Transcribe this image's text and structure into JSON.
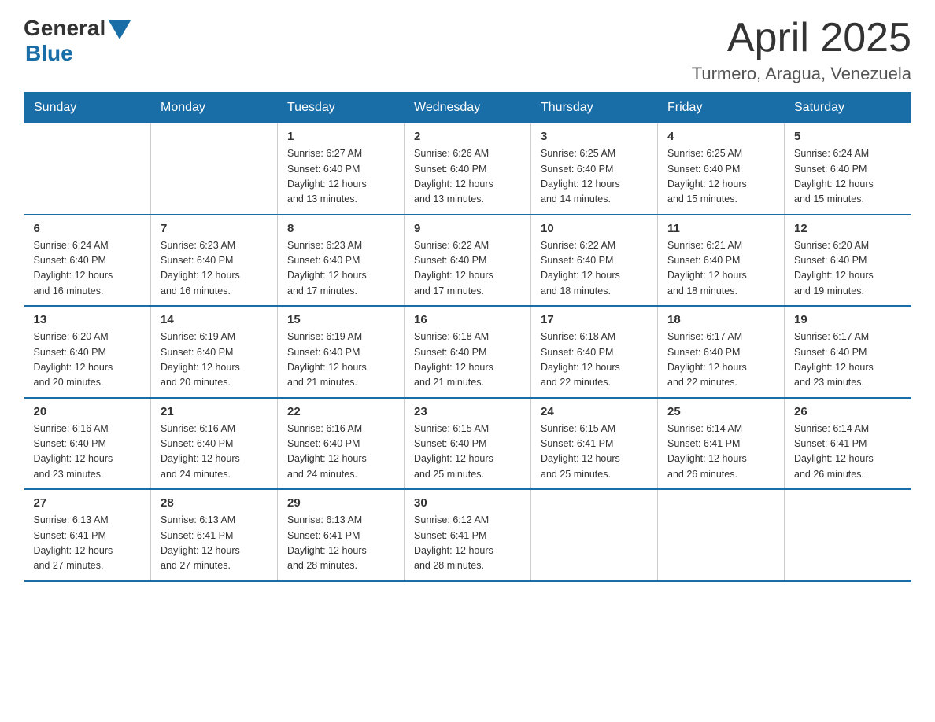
{
  "logo": {
    "general": "General",
    "blue": "Blue"
  },
  "title": "April 2025",
  "location": "Turmero, Aragua, Venezuela",
  "weekdays": [
    "Sunday",
    "Monday",
    "Tuesday",
    "Wednesday",
    "Thursday",
    "Friday",
    "Saturday"
  ],
  "weeks": [
    [
      {
        "day": "",
        "info": ""
      },
      {
        "day": "",
        "info": ""
      },
      {
        "day": "1",
        "info": "Sunrise: 6:27 AM\nSunset: 6:40 PM\nDaylight: 12 hours\nand 13 minutes."
      },
      {
        "day": "2",
        "info": "Sunrise: 6:26 AM\nSunset: 6:40 PM\nDaylight: 12 hours\nand 13 minutes."
      },
      {
        "day": "3",
        "info": "Sunrise: 6:25 AM\nSunset: 6:40 PM\nDaylight: 12 hours\nand 14 minutes."
      },
      {
        "day": "4",
        "info": "Sunrise: 6:25 AM\nSunset: 6:40 PM\nDaylight: 12 hours\nand 15 minutes."
      },
      {
        "day": "5",
        "info": "Sunrise: 6:24 AM\nSunset: 6:40 PM\nDaylight: 12 hours\nand 15 minutes."
      }
    ],
    [
      {
        "day": "6",
        "info": "Sunrise: 6:24 AM\nSunset: 6:40 PM\nDaylight: 12 hours\nand 16 minutes."
      },
      {
        "day": "7",
        "info": "Sunrise: 6:23 AM\nSunset: 6:40 PM\nDaylight: 12 hours\nand 16 minutes."
      },
      {
        "day": "8",
        "info": "Sunrise: 6:23 AM\nSunset: 6:40 PM\nDaylight: 12 hours\nand 17 minutes."
      },
      {
        "day": "9",
        "info": "Sunrise: 6:22 AM\nSunset: 6:40 PM\nDaylight: 12 hours\nand 17 minutes."
      },
      {
        "day": "10",
        "info": "Sunrise: 6:22 AM\nSunset: 6:40 PM\nDaylight: 12 hours\nand 18 minutes."
      },
      {
        "day": "11",
        "info": "Sunrise: 6:21 AM\nSunset: 6:40 PM\nDaylight: 12 hours\nand 18 minutes."
      },
      {
        "day": "12",
        "info": "Sunrise: 6:20 AM\nSunset: 6:40 PM\nDaylight: 12 hours\nand 19 minutes."
      }
    ],
    [
      {
        "day": "13",
        "info": "Sunrise: 6:20 AM\nSunset: 6:40 PM\nDaylight: 12 hours\nand 20 minutes."
      },
      {
        "day": "14",
        "info": "Sunrise: 6:19 AM\nSunset: 6:40 PM\nDaylight: 12 hours\nand 20 minutes."
      },
      {
        "day": "15",
        "info": "Sunrise: 6:19 AM\nSunset: 6:40 PM\nDaylight: 12 hours\nand 21 minutes."
      },
      {
        "day": "16",
        "info": "Sunrise: 6:18 AM\nSunset: 6:40 PM\nDaylight: 12 hours\nand 21 minutes."
      },
      {
        "day": "17",
        "info": "Sunrise: 6:18 AM\nSunset: 6:40 PM\nDaylight: 12 hours\nand 22 minutes."
      },
      {
        "day": "18",
        "info": "Sunrise: 6:17 AM\nSunset: 6:40 PM\nDaylight: 12 hours\nand 22 minutes."
      },
      {
        "day": "19",
        "info": "Sunrise: 6:17 AM\nSunset: 6:40 PM\nDaylight: 12 hours\nand 23 minutes."
      }
    ],
    [
      {
        "day": "20",
        "info": "Sunrise: 6:16 AM\nSunset: 6:40 PM\nDaylight: 12 hours\nand 23 minutes."
      },
      {
        "day": "21",
        "info": "Sunrise: 6:16 AM\nSunset: 6:40 PM\nDaylight: 12 hours\nand 24 minutes."
      },
      {
        "day": "22",
        "info": "Sunrise: 6:16 AM\nSunset: 6:40 PM\nDaylight: 12 hours\nand 24 minutes."
      },
      {
        "day": "23",
        "info": "Sunrise: 6:15 AM\nSunset: 6:40 PM\nDaylight: 12 hours\nand 25 minutes."
      },
      {
        "day": "24",
        "info": "Sunrise: 6:15 AM\nSunset: 6:41 PM\nDaylight: 12 hours\nand 25 minutes."
      },
      {
        "day": "25",
        "info": "Sunrise: 6:14 AM\nSunset: 6:41 PM\nDaylight: 12 hours\nand 26 minutes."
      },
      {
        "day": "26",
        "info": "Sunrise: 6:14 AM\nSunset: 6:41 PM\nDaylight: 12 hours\nand 26 minutes."
      }
    ],
    [
      {
        "day": "27",
        "info": "Sunrise: 6:13 AM\nSunset: 6:41 PM\nDaylight: 12 hours\nand 27 minutes."
      },
      {
        "day": "28",
        "info": "Sunrise: 6:13 AM\nSunset: 6:41 PM\nDaylight: 12 hours\nand 27 minutes."
      },
      {
        "day": "29",
        "info": "Sunrise: 6:13 AM\nSunset: 6:41 PM\nDaylight: 12 hours\nand 28 minutes."
      },
      {
        "day": "30",
        "info": "Sunrise: 6:12 AM\nSunset: 6:41 PM\nDaylight: 12 hours\nand 28 minutes."
      },
      {
        "day": "",
        "info": ""
      },
      {
        "day": "",
        "info": ""
      },
      {
        "day": "",
        "info": ""
      }
    ]
  ]
}
